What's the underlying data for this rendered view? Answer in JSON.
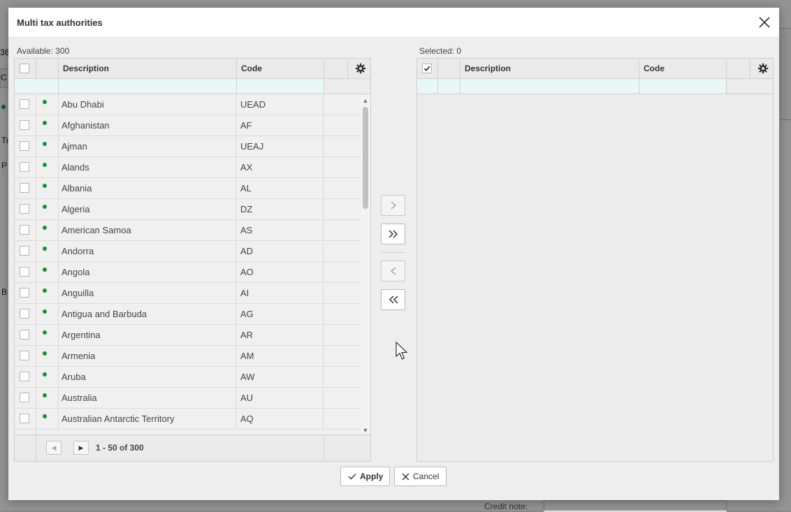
{
  "background": {
    "fragments": [
      "36",
      "C",
      "Tr",
      "P",
      "B",
      "Credit note:"
    ]
  },
  "dialog": {
    "title": "Multi tax authorities",
    "close_icon": "close-icon"
  },
  "available": {
    "label": "Available: 300",
    "columns": [
      "Description",
      "Code"
    ],
    "rows": [
      {
        "description": "Abu Dhabi",
        "code": "UEAD"
      },
      {
        "description": "Afghanistan",
        "code": "AF"
      },
      {
        "description": "Ajman",
        "code": "UEAJ"
      },
      {
        "description": "Alands",
        "code": "AX"
      },
      {
        "description": "Albania",
        "code": "AL"
      },
      {
        "description": "Algeria",
        "code": "DZ"
      },
      {
        "description": "American Samoa",
        "code": "AS"
      },
      {
        "description": "Andorra",
        "code": "AD"
      },
      {
        "description": "Angola",
        "code": "AO"
      },
      {
        "description": "Anguilla",
        "code": "AI"
      },
      {
        "description": "Antigua and Barbuda",
        "code": "AG"
      },
      {
        "description": "Argentina",
        "code": "AR"
      },
      {
        "description": "Armenia",
        "code": "AM"
      },
      {
        "description": "Aruba",
        "code": "AW"
      },
      {
        "description": "Australia",
        "code": "AU"
      },
      {
        "description": "Australian Antarctic Territory",
        "code": "AQ"
      }
    ],
    "pager": {
      "text": "1 - 50 of 300"
    },
    "status_color": "#11913a"
  },
  "selected": {
    "label": "Selected: 0",
    "columns": [
      "Description",
      "Code"
    ]
  },
  "transfer": {
    "move_right_icon": "chevron-right-icon",
    "move_all_right_icon": "double-chevron-right-icon",
    "move_left_icon": "chevron-left-icon",
    "move_all_left_icon": "double-chevron-left-icon"
  },
  "footer": {
    "apply_label": "Apply",
    "cancel_label": "Cancel"
  }
}
